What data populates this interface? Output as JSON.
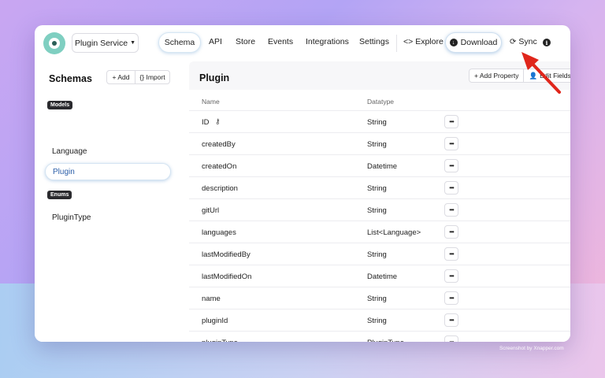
{
  "header": {
    "service_selector": "Plugin Service",
    "nav": {
      "schema": "Schema",
      "api": "API",
      "store": "Store",
      "events": "Events",
      "integrations": "Integrations",
      "settings": "Settings",
      "explore": "Explore",
      "explore_icon": "<>",
      "download": "Download",
      "sync": "Sync"
    }
  },
  "sidebar": {
    "title": "Schemas",
    "add_label": "+ Add",
    "import_label": "{} Import",
    "models_tag": "Models",
    "models": [
      "Language",
      "Plugin"
    ],
    "active_model": "Plugin",
    "enums_tag": "Enums",
    "enums": [
      "PluginType"
    ]
  },
  "main": {
    "title": "Plugin",
    "add_property": "+ Add Property",
    "edit_fields": "Edit Fields",
    "columns": {
      "name": "Name",
      "datatype": "Datatype"
    },
    "rows": [
      {
        "name": "ID",
        "type": "String",
        "key": true
      },
      {
        "name": "createdBy",
        "type": "String"
      },
      {
        "name": "createdOn",
        "type": "Datetime"
      },
      {
        "name": "description",
        "type": "String"
      },
      {
        "name": "gitUrl",
        "type": "String"
      },
      {
        "name": "languages",
        "type": "List<Language>"
      },
      {
        "name": "lastModifiedBy",
        "type": "String"
      },
      {
        "name": "lastModifiedOn",
        "type": "Datetime"
      },
      {
        "name": "name",
        "type": "String"
      },
      {
        "name": "pluginId",
        "type": "String"
      },
      {
        "name": "pluginType",
        "type": "PluginType"
      }
    ],
    "row_menu": "•••"
  },
  "watermark": "Screenshot by Xnapper.com",
  "colors": {
    "accent": "#2b5ea8",
    "annotation_arrow": "#e0261b",
    "logo": "#7fcfc1"
  }
}
